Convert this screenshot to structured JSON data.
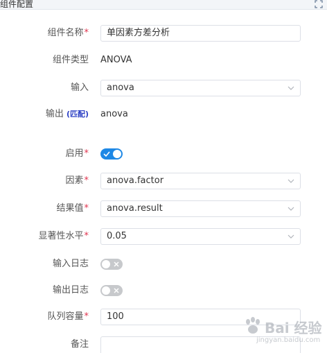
{
  "header": {
    "title": "组件配置"
  },
  "fields": {
    "name": {
      "label": "组件名称",
      "required": "*",
      "value": "单因素方差分析"
    },
    "type": {
      "label": "组件类型",
      "value": "ANOVA"
    },
    "input": {
      "label": "输入",
      "value": "anova"
    },
    "output": {
      "label": "输出",
      "tag": "(匹配)",
      "value": "anova"
    },
    "enabled": {
      "label": "启用",
      "required": "*",
      "state": true
    },
    "factor": {
      "label": "因素",
      "required": "*",
      "value": "anova.factor"
    },
    "result": {
      "label": "结果值",
      "required": "*",
      "value": "anova.result"
    },
    "significance": {
      "label": "显著性水平",
      "required": "*",
      "value": "0.05"
    },
    "input_log": {
      "label": "输入日志",
      "state": false
    },
    "output_log": {
      "label": "输出日志",
      "state": false
    },
    "queue_capacity": {
      "label": "队列容量",
      "required": "*",
      "value": "100"
    },
    "notes": {
      "label": "备注",
      "value": ""
    }
  },
  "watermark": {
    "text": "Bai 经验",
    "sub": "jingyan.baidu.com"
  },
  "colors": {
    "accent": "#1e88e5",
    "required": "#e0334e",
    "match_tag": "#2b3fc4",
    "switch_off": "#c7c9cc"
  }
}
